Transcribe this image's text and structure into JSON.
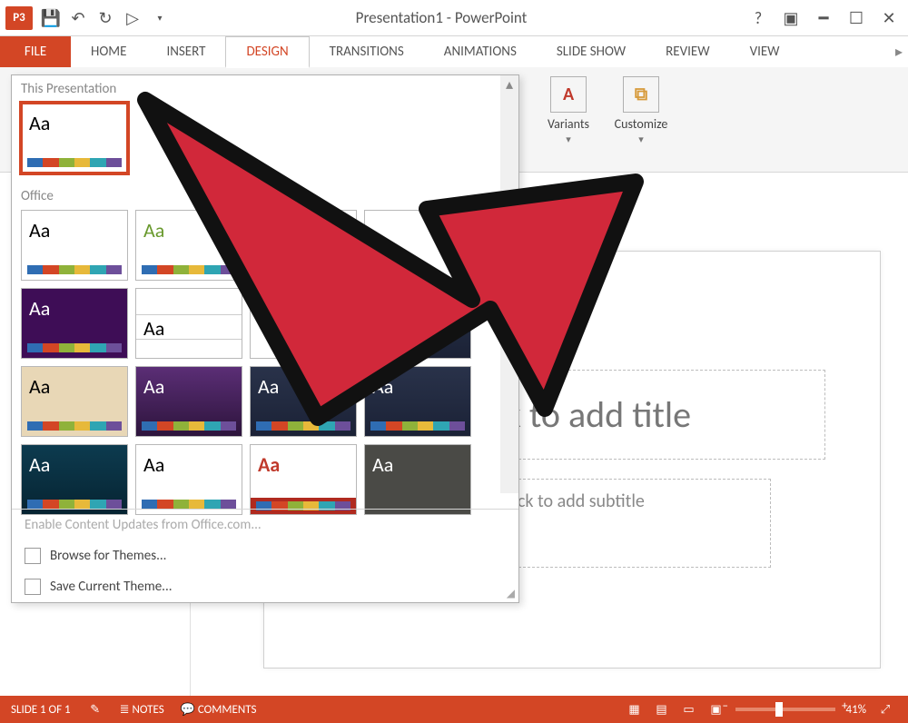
{
  "window": {
    "title": "Presentation1 - PowerPoint"
  },
  "tabs": {
    "file": "FILE",
    "items": [
      "HOME",
      "INSERT",
      "DESIGN",
      "TRANSITIONS",
      "ANIMATIONS",
      "SLIDE SHOW",
      "REVIEW",
      "VIEW"
    ],
    "active": "DESIGN"
  },
  "ribbon": {
    "variants": "Variants",
    "customize": "Customize"
  },
  "themesPanel": {
    "sectionThis": "This Presentation",
    "sectionOffice": "Office",
    "enableUpdates": "Enable Content Updates from Office.com...",
    "browse": "Browse for Themes...",
    "saveTheme": "Save Current Theme..."
  },
  "slide": {
    "titlePlaceholder": "Click to add title",
    "subtitlePlaceholder": "Click to add subtitle"
  },
  "status": {
    "slideIndicator": "SLIDE 1 OF 1",
    "notes": "NOTES",
    "comments": "COMMENTS",
    "zoom": "41%"
  }
}
